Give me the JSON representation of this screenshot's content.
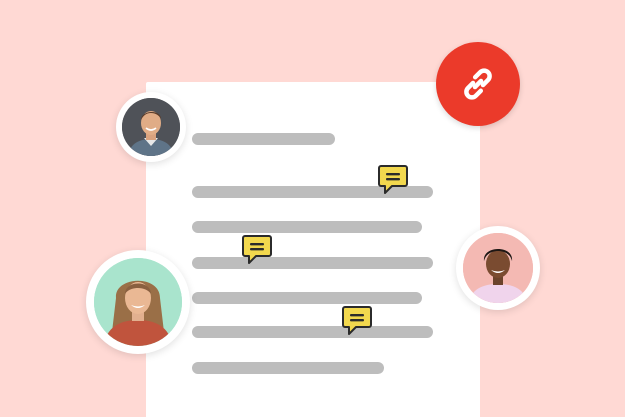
{
  "colors": {
    "background": "#ffd9d4",
    "document": "#ffffff",
    "text_placeholder_lines": "#bdbdbd",
    "comment_bubble": "#f2d84e",
    "link_badge": "#eb3a2a"
  },
  "icons": {
    "link": "link-icon",
    "comment": "comment-icon"
  },
  "document": {
    "line_count": 7,
    "comment_count": 3
  },
  "avatars": [
    "avatar-man-top-left",
    "avatar-woman-left",
    "avatar-man-right"
  ]
}
